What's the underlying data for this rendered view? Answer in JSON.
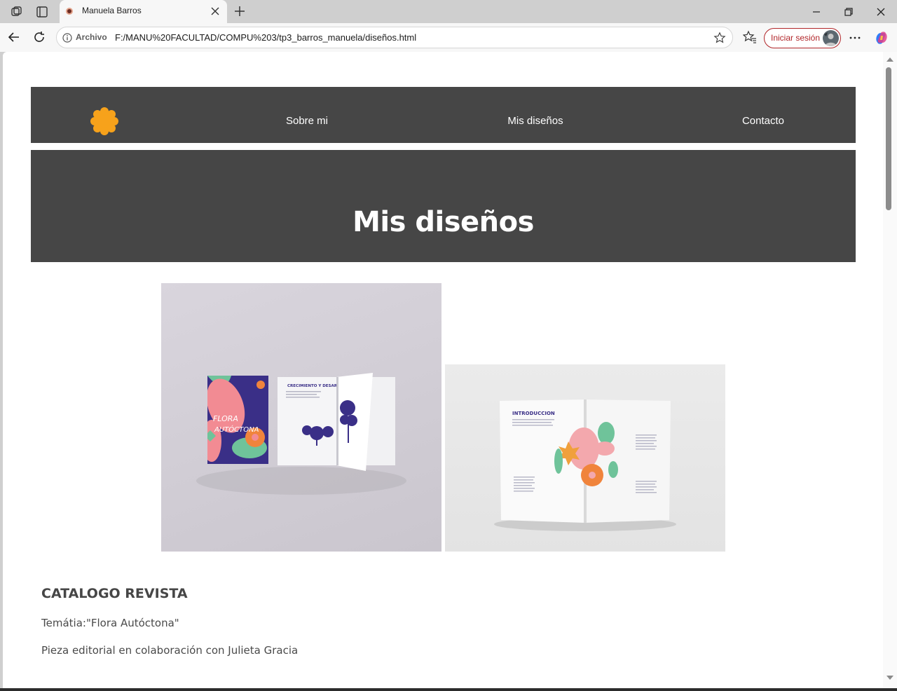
{
  "browser": {
    "tab_title": "Manuela Barros",
    "site_info_label": "Archivo",
    "url": "F:/MANU%20FACULTAD/COMPU%203/tp3_barros_manuela/diseños.html",
    "signin_label": "Iniciar sesión"
  },
  "page": {
    "nav": {
      "links": [
        "Sobre mi",
        "Mis diseños",
        "Contacto"
      ]
    },
    "hero": {
      "title": "Mis diseños"
    },
    "project": {
      "title": "CATALOGO REVISTA",
      "theme": "Temátia:\"Flora Autóctona\"",
      "description": "Pieza editorial en colaboración con Julieta Gracia"
    },
    "images": {
      "catalog_cover_text": [
        "FLORA",
        "AUTÓCTONA"
      ],
      "catalog_spread_heading": "CRECIMIENTO Y DESARROLLO",
      "magazine_heading": "INTRODUCCION"
    }
  },
  "colors": {
    "nav_background": "#464646",
    "logo_orange": "#f7a21b",
    "signin_accent": "#b1262a"
  }
}
